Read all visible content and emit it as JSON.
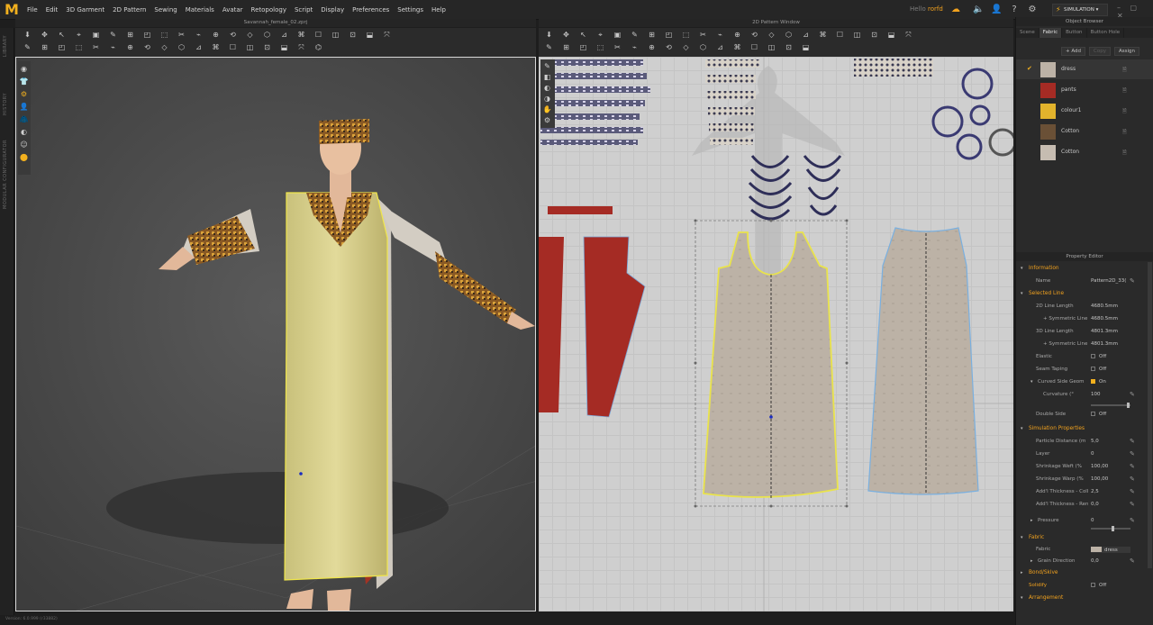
{
  "app": {
    "logo_glyph": "M",
    "menus": [
      "File",
      "Edit",
      "3D Garment",
      "2D Pattern",
      "Sewing",
      "Materials",
      "Avatar",
      "Retopology",
      "Script",
      "Display",
      "Preferences",
      "Settings",
      "Help"
    ],
    "user_label": "Hello",
    "user_name": "rorfd",
    "simulation_label": "SIMULATION",
    "accent_color": "#f2b01e"
  },
  "viewport3d": {
    "title": "Savannah_female_02.zprj",
    "side_labels": [
      "LIBRARY",
      "HISTORY",
      "MODULAR CONFIGURATOR"
    ]
  },
  "viewport2d": {
    "title": "2D Pattern Window"
  },
  "object_browser": {
    "title": "Object Browser",
    "tabs": [
      "Scene",
      "Fabric",
      "Button",
      "Button Hole"
    ],
    "active_tab": "Fabric",
    "add_label": "+ Add",
    "copy_label": "Copy",
    "assign_label": "Assign",
    "fabrics": [
      {
        "name": "dress",
        "color": "#bcb2a6",
        "selected": true
      },
      {
        "name": "pants",
        "color": "#a52b24",
        "selected": false
      },
      {
        "name": "colour1",
        "color": "#e2b32c",
        "selected": false
      },
      {
        "name": "Cotton",
        "color": "#6a5036",
        "selected": false
      },
      {
        "name": "Cotton",
        "color": "#c6bcb1",
        "selected": false
      }
    ]
  },
  "property_editor": {
    "title": "Property Editor",
    "information": "Information",
    "name_label": "Name",
    "name_value": "Pattern2D_33(",
    "selected_line": "Selected Line",
    "line_2d": {
      "label": "2D Line Length",
      "value": "4680.5mm"
    },
    "sym_line_1": {
      "label": "+ Symmetric Line",
      "value": "4680.5mm"
    },
    "line_3d": {
      "label": "3D Line Length",
      "value": "4801.3mm"
    },
    "sym_line_2": {
      "label": "+ Symmetric Line",
      "value": "4801.3mm"
    },
    "elastic": {
      "label": "Elastic",
      "value": "Off"
    },
    "seam_taping": {
      "label": "Seam Taping",
      "value": "Off"
    },
    "curved_side": {
      "label": "Curved Side Geom",
      "value": "On"
    },
    "curvature": {
      "label": "Curvature (°",
      "value": "100"
    },
    "double_side": {
      "label": "Double Side",
      "value": "Off"
    },
    "simulation_properties": "Simulation Properties",
    "particle_distance": {
      "label": "Particle Distance (m",
      "value": "5,0"
    },
    "layer": {
      "label": "Layer",
      "value": "0"
    },
    "shrink_weft": {
      "label": "Shrinkage Weft (%",
      "value": "100,00"
    },
    "shrink_warp": {
      "label": "Shrinkage Warp (%",
      "value": "100,00"
    },
    "add_thick_coll": {
      "label": "Add'l Thickness - Colli",
      "value": "2,5"
    },
    "add_thick_rend": {
      "label": "Add'l Thickness - Rend",
      "value": "0,0"
    },
    "pressure": {
      "label": "Pressure",
      "value": "0"
    },
    "fabric_section": "Fabric",
    "fabric_row": {
      "label": "Fabric",
      "value": "dress"
    },
    "grain_direction": {
      "label": "Grain Direction",
      "value": "0,0"
    },
    "bond_skive": "Bond/Skive",
    "solidify": {
      "label": "Solidify",
      "value": "Off"
    },
    "arrangement": "Arrangement"
  },
  "status": {
    "text": "Version: 6.0.999 (r33882)"
  }
}
